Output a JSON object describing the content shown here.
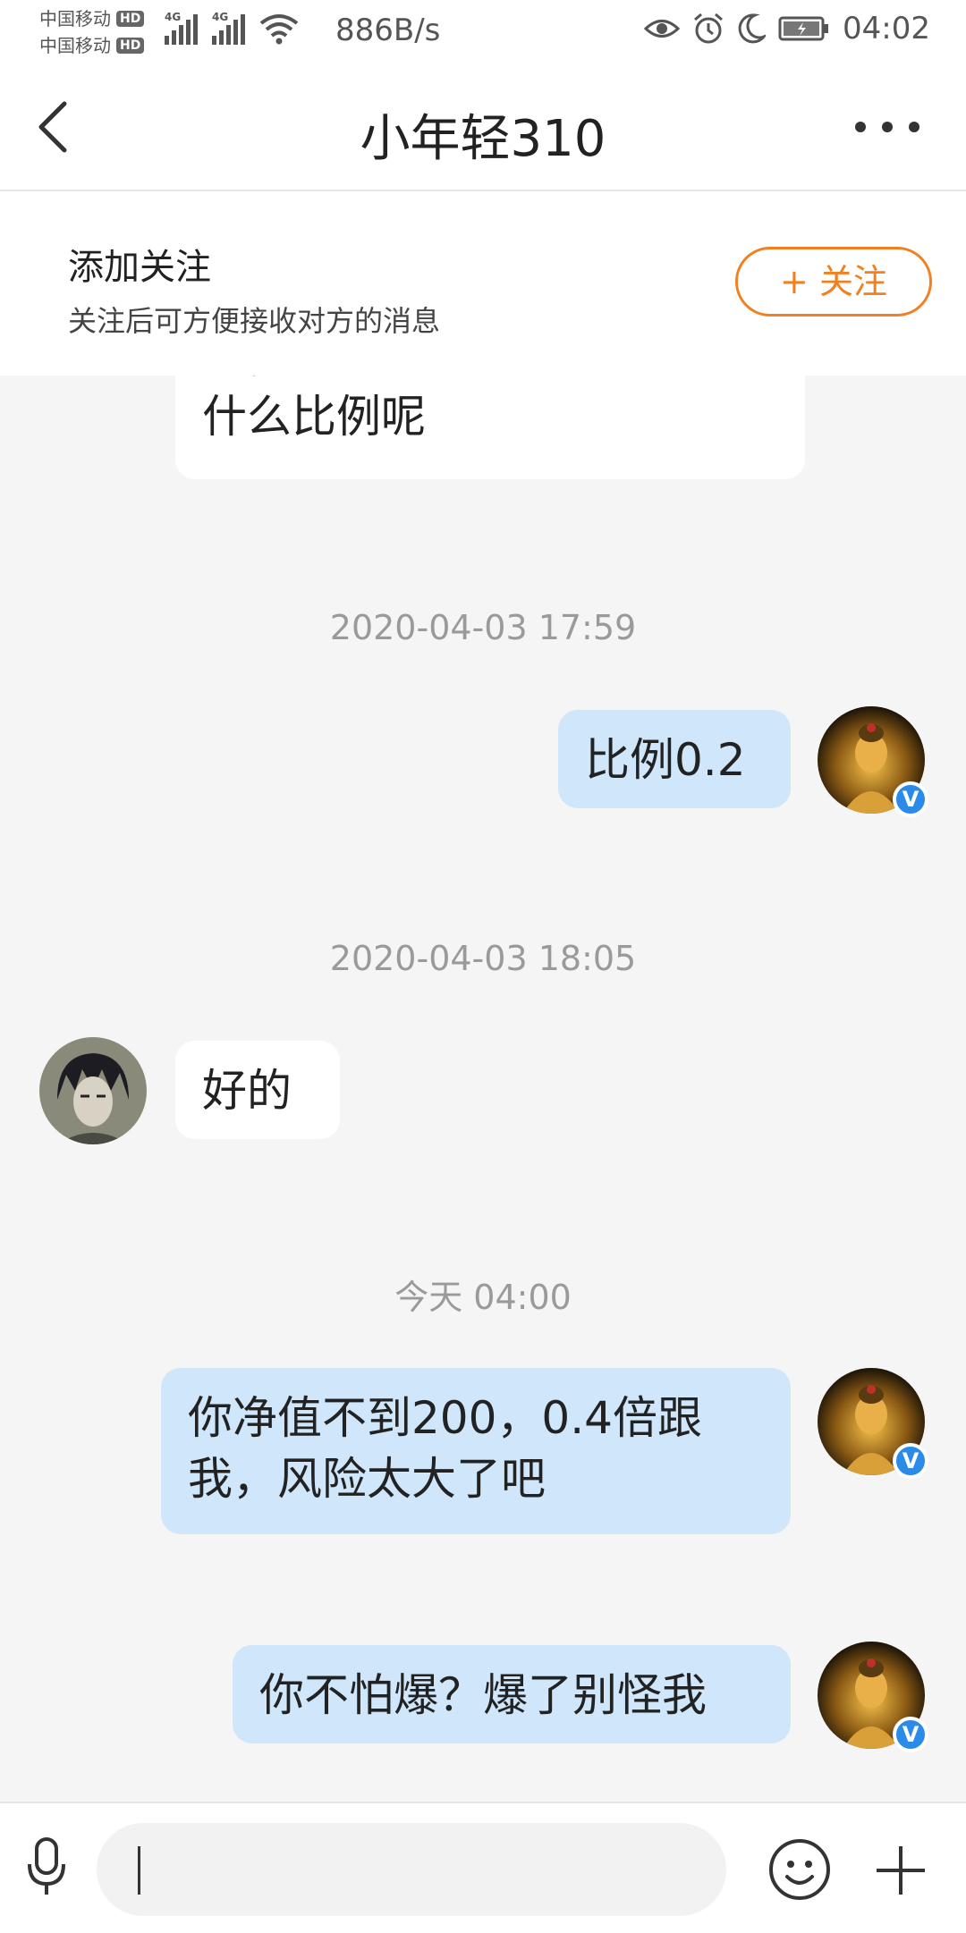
{
  "status_bar": {
    "carrier_1": "中国移动",
    "carrier_2": "中国移动",
    "hd_badge": "HD",
    "network_label": "4G",
    "net_speed": "886B/s",
    "time": "04:02"
  },
  "header": {
    "title": "小年轻310"
  },
  "follow_banner": {
    "title": "添加关注",
    "subtitle": "关注后可方便接收对方的消息",
    "button_label": "+ 关注"
  },
  "chat": {
    "partial_message": "点，你推荐什么手数还是\n什么比例呢",
    "messages": [
      {
        "type": "timestamp",
        "text": "2020-04-03 17:59"
      },
      {
        "type": "sent",
        "text": "比例0.2"
      },
      {
        "type": "timestamp",
        "text": "2020-04-03 18:05"
      },
      {
        "type": "received",
        "text": "好的"
      },
      {
        "type": "timestamp",
        "text": "今天 04:00"
      },
      {
        "type": "sent",
        "text": "你净值不到200，0.4倍跟\n我，风险太大了吧"
      },
      {
        "type": "sent",
        "text": "你不怕爆？爆了别怪我"
      }
    ],
    "verified_badge": "V"
  },
  "input_bar": {
    "placeholder": ""
  },
  "colors": {
    "accent_orange": "#f08020",
    "sent_bubble": "#cfe6fb",
    "received_bubble": "#ffffff",
    "background": "#f5f5f5",
    "verified_blue": "#2b8be8"
  }
}
